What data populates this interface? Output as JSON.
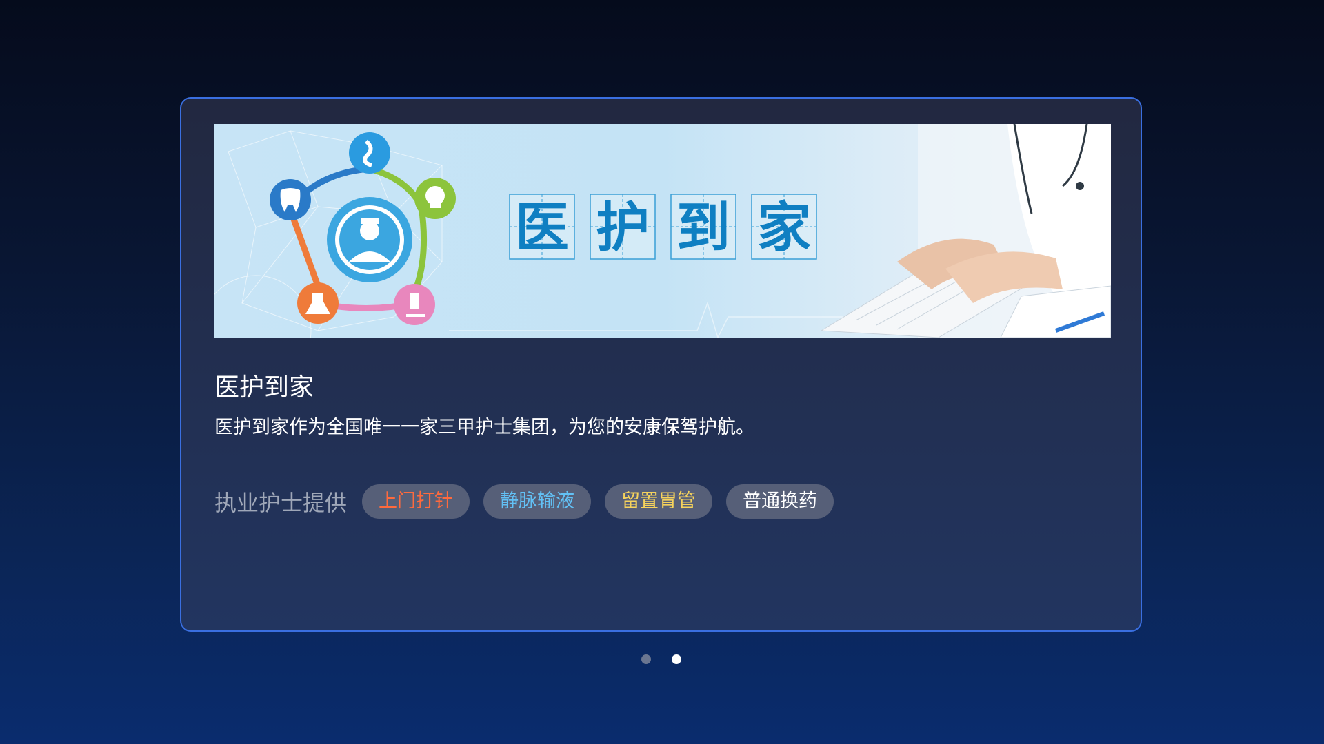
{
  "card": {
    "banner": {
      "title_chars": [
        "医",
        "护",
        "到",
        "家"
      ],
      "icons": [
        "stomach-icon",
        "tooth-icon",
        "skull-icon",
        "nurse-icon",
        "flask-icon",
        "microscope-icon"
      ],
      "colors": {
        "title": "#0f7fc2",
        "stomach": "#2a9be0",
        "tooth": "#2a7ac8",
        "skull": "#8cc43c",
        "flask": "#ef7b3a",
        "microscope": "#e887bd",
        "center": "#3ba6e0"
      }
    },
    "title": "医护到家",
    "description": "医护到家作为全国唯一一家三甲护士集团，为您的安康保驾护航。",
    "services": {
      "label": "执业护士提供",
      "tags": [
        {
          "label": "上门打针",
          "color": "#ff6a3d"
        },
        {
          "label": "静脉输液",
          "color": "#62c1f5"
        },
        {
          "label": "留置胃管",
          "color": "#f6d35c"
        },
        {
          "label": "普通换药",
          "color": "#ffffff"
        }
      ]
    }
  },
  "pagination": {
    "total": 2,
    "active_index": 1,
    "colors": {
      "active": "#ffffff",
      "inactive": "#6a7691"
    }
  }
}
